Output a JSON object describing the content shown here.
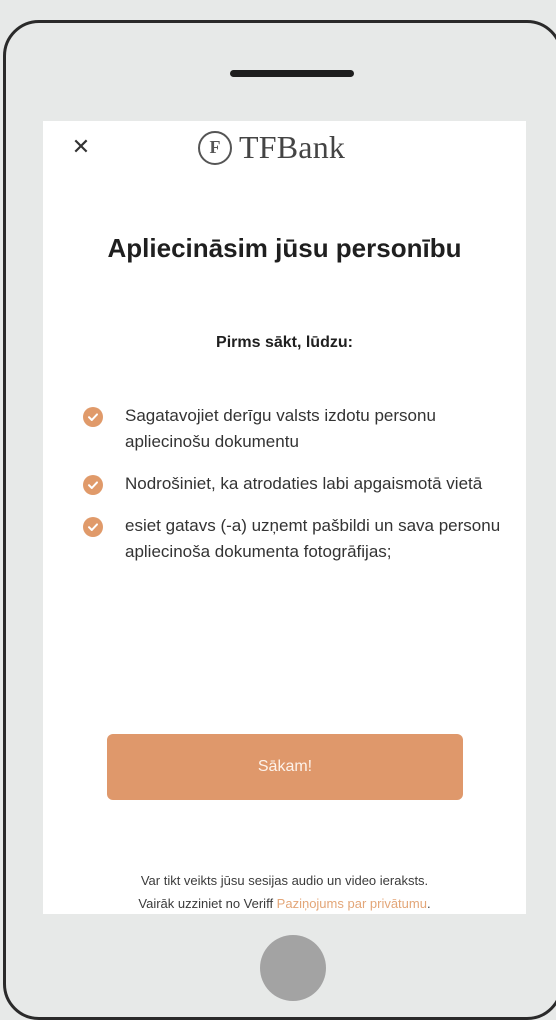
{
  "header": {
    "close_symbol": "✕",
    "brand_logo_letter": "F",
    "brand_name": "TFBank"
  },
  "main": {
    "title": "Apliecināsim jūsu personību",
    "subtitle": "Pirms sākt, lūdzu:",
    "checklist": [
      "Sagatavojiet derīgu valsts izdotu personu apliecinošu dokumentu",
      "Nodrošiniet, ka atrodaties labi apgaismotā vietā",
      "esiet gatavs (-a) uzņemt pašbildi un sava personu apliecinoša dokumenta fotogrāfijas;"
    ],
    "start_button_label": "Sākam!"
  },
  "footer": {
    "line1": "Var tikt veikts jūsu sesijas audio un video ieraksts.",
    "line2_prefix": "Vairāk uzziniet no Veriff ",
    "privacy_link": "Paziņojums par privātumu",
    "line2_suffix": "."
  },
  "colors": {
    "accent": "#df986b",
    "link": "#e3a678",
    "check_icon": "#e09a6a"
  },
  "icons": [
    "close-icon",
    "brand-logo-icon",
    "check-icon"
  ]
}
